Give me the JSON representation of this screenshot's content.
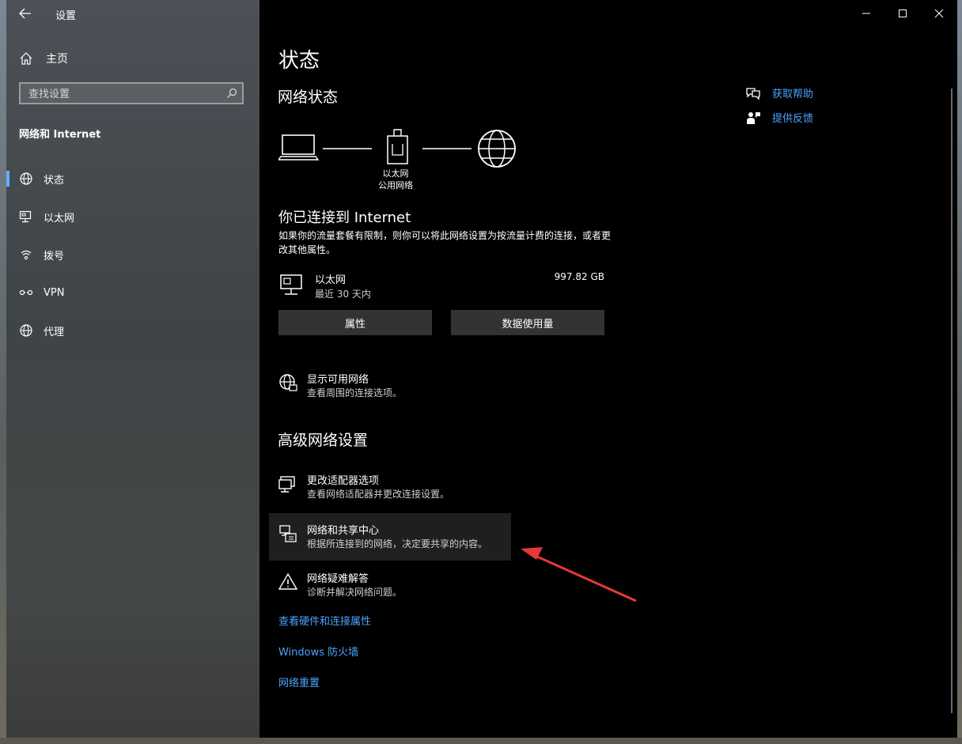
{
  "app": {
    "title": "设置"
  },
  "sidebar": {
    "home_label": "主页",
    "search_placeholder": "查找设置",
    "section_title": "网络和 Internet",
    "items": [
      {
        "label": "状态",
        "icon": "globe-icon",
        "active": true
      },
      {
        "label": "以太网",
        "icon": "ethernet-icon"
      },
      {
        "label": "拨号",
        "icon": "dialup-icon"
      },
      {
        "label": "VPN",
        "icon": "vpn-icon"
      },
      {
        "label": "代理",
        "icon": "globe-icon"
      }
    ]
  },
  "main": {
    "page_title": "状态",
    "network_status_heading": "网络状态",
    "diagram": {
      "label_line1": "以太网",
      "label_line2": "公用网络"
    },
    "connected_title": "你已连接到 Internet",
    "connected_desc": "如果你的流量套餐有限制，则你可以将此网络设置为按流量计费的连接，或者更改其他属性。",
    "adapter": {
      "name": "以太网",
      "period": "最近 30 天内",
      "usage": "997.82 GB"
    },
    "buttons": {
      "properties": "属性",
      "data_usage": "数据使用量"
    },
    "show_networks": {
      "title": "显示可用网络",
      "sub": "查看周围的连接选项。"
    },
    "advanced_heading": "高级网络设置",
    "advanced_items": [
      {
        "title": "更改适配器选项",
        "sub": "查看网络适配器并更改连接设置。",
        "icon": "adapter-icon"
      },
      {
        "title": "网络和共享中心",
        "sub": "根据所连接到的网络，决定要共享的内容。",
        "icon": "sharing-center-icon"
      },
      {
        "title": "网络疑难解答",
        "sub": "诊断并解决网络问题。",
        "icon": "warning-icon"
      }
    ],
    "links": {
      "hardware": "查看硬件和连接属性",
      "firewall": "Windows 防火墙",
      "reset": "网络重置"
    }
  },
  "help": {
    "get_help": "获取帮助",
    "feedback": "提供反馈"
  },
  "colors": {
    "accent": "#4ba3ff",
    "annotation": "#e53935"
  }
}
